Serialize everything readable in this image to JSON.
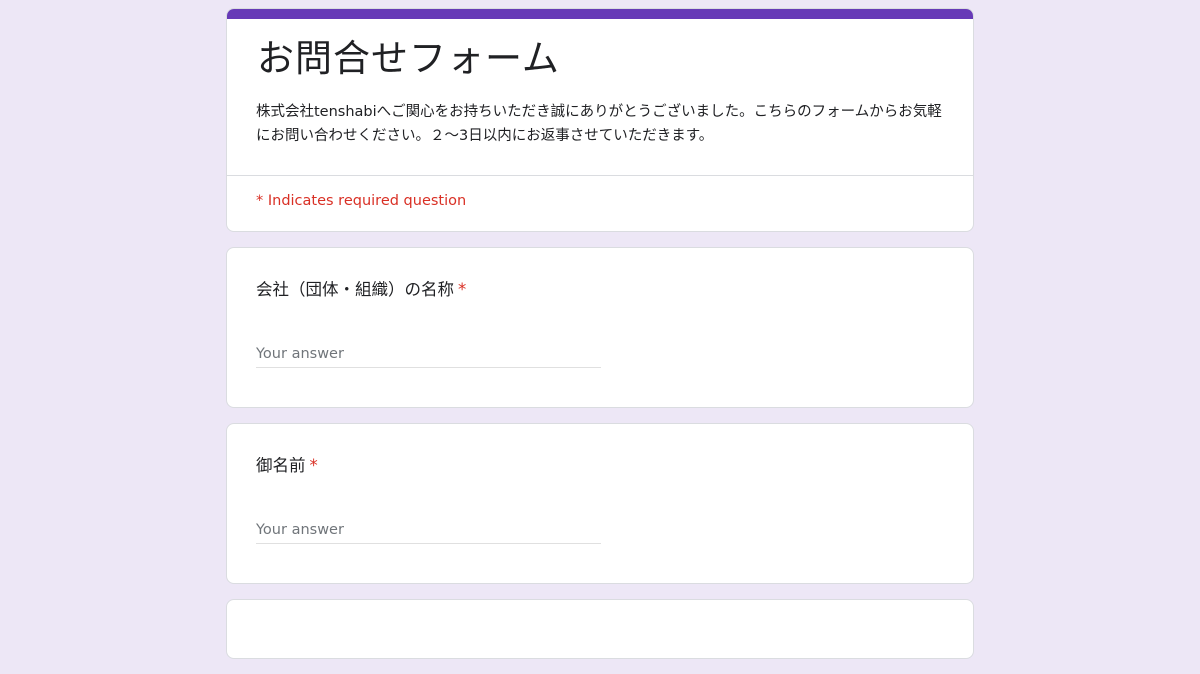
{
  "header": {
    "title": "お問合せフォーム",
    "description": "株式会社tenshabiへご関心をお持ちいただき誠にありがとうございました。こちらのフォームからお気軽にお問い合わせください。２〜3日以内にお返事させていただきます。",
    "required_note": "* Indicates required question"
  },
  "questions": [
    {
      "title": "会社（団体・組織）の名称",
      "required_mark": "*",
      "placeholder": "Your answer",
      "value": ""
    },
    {
      "title": "御名前",
      "required_mark": "*",
      "placeholder": "Your answer",
      "value": ""
    }
  ],
  "colors": {
    "page_background": "#ede7f6",
    "accent": "#673ab7",
    "required": "#d93025"
  }
}
